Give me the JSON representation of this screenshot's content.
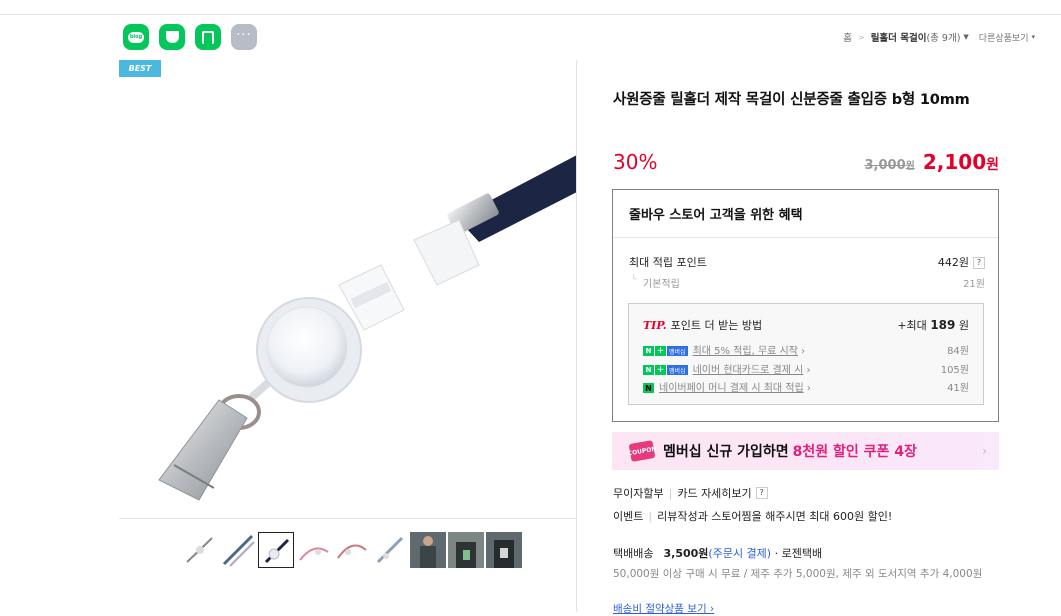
{
  "share": {
    "icons": [
      "blog-icon",
      "cafe-icon",
      "bookmark-icon",
      "more-icon"
    ],
    "blog_text": "blog"
  },
  "breadcrumb": {
    "home": "홈",
    "category": "릴홀더 목걸이",
    "count": "(총 9개)",
    "other": "다른상품보기"
  },
  "badge": "BEST",
  "product": {
    "title": "사원증줄 릴홀더 제작 목걸이 신분증줄 출입증 b형 10mm",
    "discount": "30%",
    "original_price": "3,000",
    "original_unit": "원",
    "sale_price": "2,100",
    "sale_unit": "원"
  },
  "benefit": {
    "heading": "줄바우 스토어 고객을 위한 혜택",
    "max_points_label": "최대 적립 포인트",
    "max_points_value": "442원",
    "help": "?",
    "basic_label": "기본적립",
    "basic_value": "21원",
    "tip_label": "TIP.",
    "tip_text": "포인트 더 받는 방법",
    "tip_max_prefix": "+최대",
    "tip_max_value": "189",
    "tip_max_unit": "원",
    "tips": [
      {
        "text": "최대 5% 적립, 무료 시작",
        "value": "84원",
        "badge": "membership"
      },
      {
        "text": "네이버 현대카드로 결제 시",
        "value": "105원",
        "badge": "membership"
      },
      {
        "text": "네이버페이 머니 결제 시 최대 적립",
        "value": "41원",
        "badge": "pay"
      }
    ],
    "badge_n": "N",
    "badge_plus": "+",
    "badge_m": "멤버십"
  },
  "member_banner": {
    "coupon_text": "COUPON",
    "prefix": "멤버십 신규 가입하면",
    "highlight": "8천원 할인 쿠폰 4장",
    "arrow": "›"
  },
  "payment": {
    "installment": "무이자할부",
    "card": "카드 자세히보기",
    "event_label": "이벤트",
    "event_text": "리뷰작성과 스토어찜을 해주시면 최대 600원 할인!"
  },
  "shipping": {
    "label": "택배배송",
    "price": "3,500원",
    "pay": "(주문시 결제)",
    "carrier": "· 로젠택배",
    "note": "50,000원 이상 구매 시 무료 / 제주 추가 5,000원, 제주 외 도서지역 추가 4,000원",
    "link": "배송비 절약상품 보기 ›"
  },
  "thumbnails": 9
}
